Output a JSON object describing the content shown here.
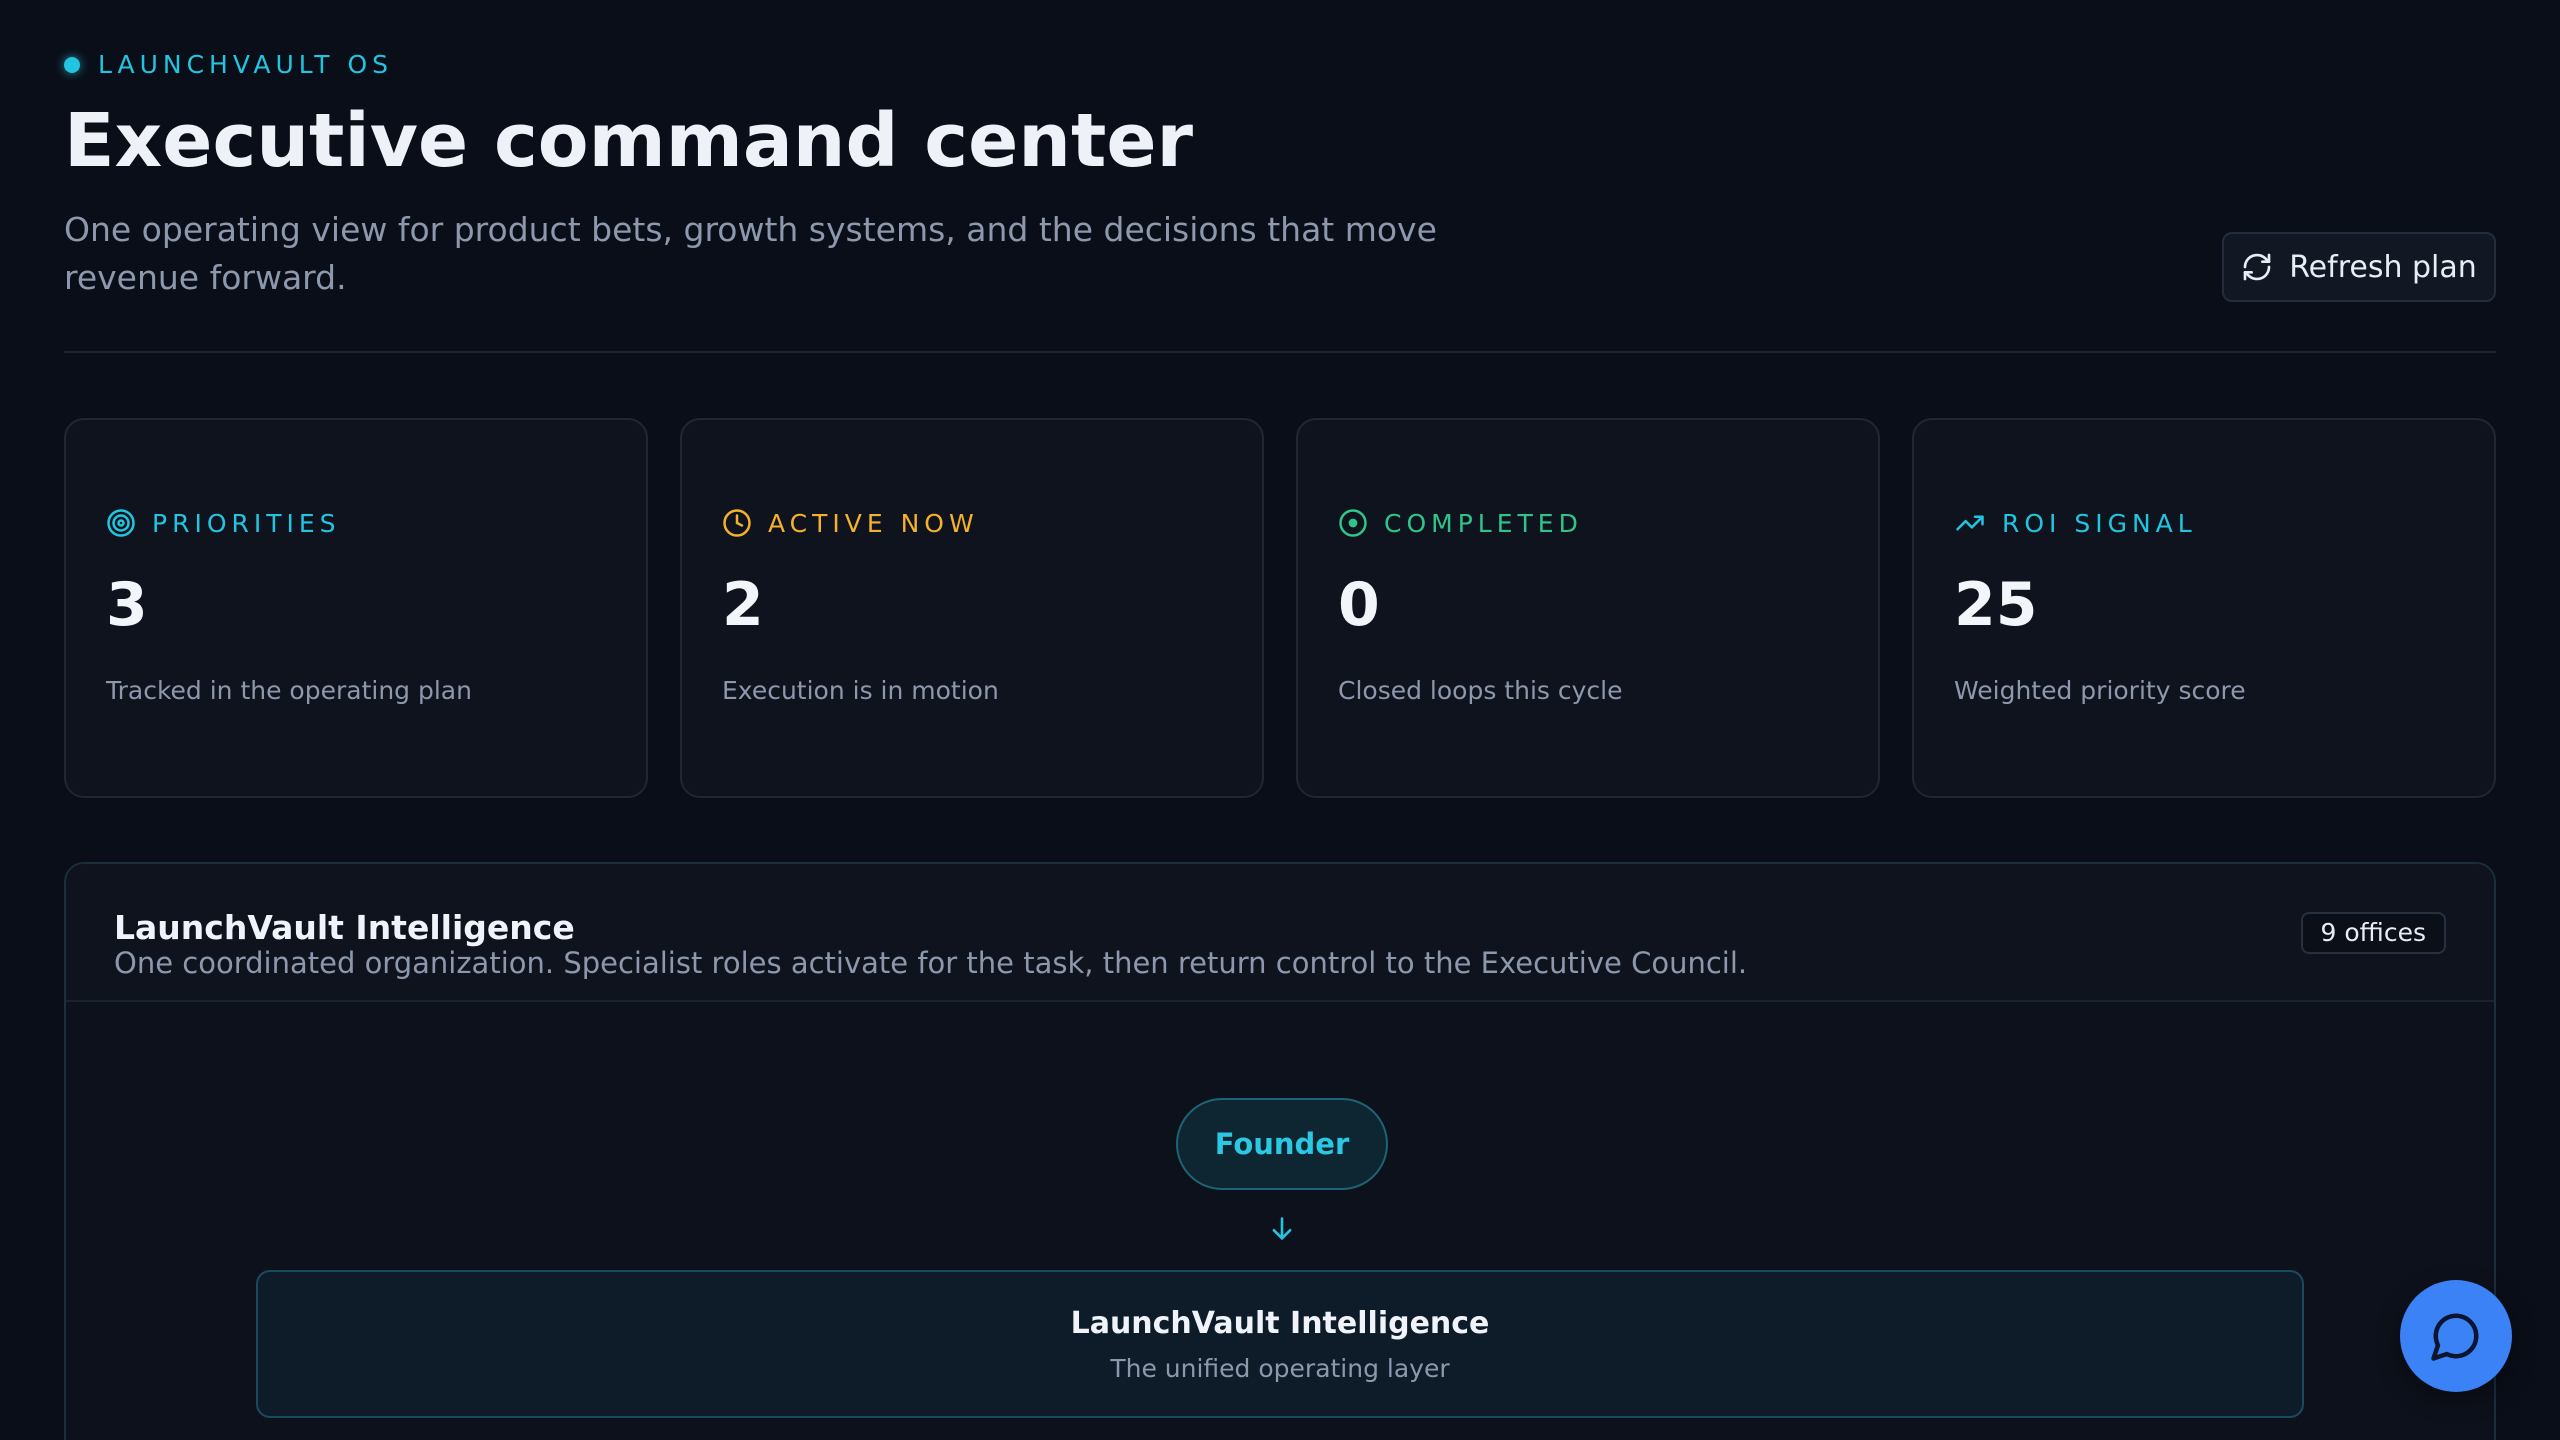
{
  "header": {
    "eyebrow": "LAUNCHVAULT OS",
    "title": "Executive command center",
    "subtitle": "One operating view for product bets, growth systems, and the decisions that move revenue forward.",
    "refresh_label": "Refresh plan"
  },
  "stats": [
    {
      "icon": "target-icon",
      "label": "PRIORITIES",
      "value": "3",
      "desc": "Tracked in the operating plan",
      "color": "#22c5e0"
    },
    {
      "icon": "clock-icon",
      "label": "ACTIVE NOW",
      "value": "2",
      "desc": "Execution is in motion",
      "color": "#f4b12c"
    },
    {
      "icon": "check-circle-icon",
      "label": "COMPLETED",
      "value": "0",
      "desc": "Closed loops this cycle",
      "color": "#2fc58a"
    },
    {
      "icon": "trending-up-icon",
      "label": "ROI SIGNAL",
      "value": "25",
      "desc": "Weighted priority score",
      "color": "#22c5e0"
    }
  ],
  "intelligence": {
    "title": "LaunchVault Intelligence",
    "description": "One coordinated organization. Specialist roles activate for the task, then return control to the Executive Council.",
    "offices_badge": "9 offices",
    "founder_label": "Founder",
    "core_title": "LaunchVault Intelligence",
    "core_subtitle": "The unified operating layer"
  },
  "colors": {
    "accent": "#22c5e0",
    "chat_fab": "#3b82f6",
    "background": "#0a0e18"
  }
}
